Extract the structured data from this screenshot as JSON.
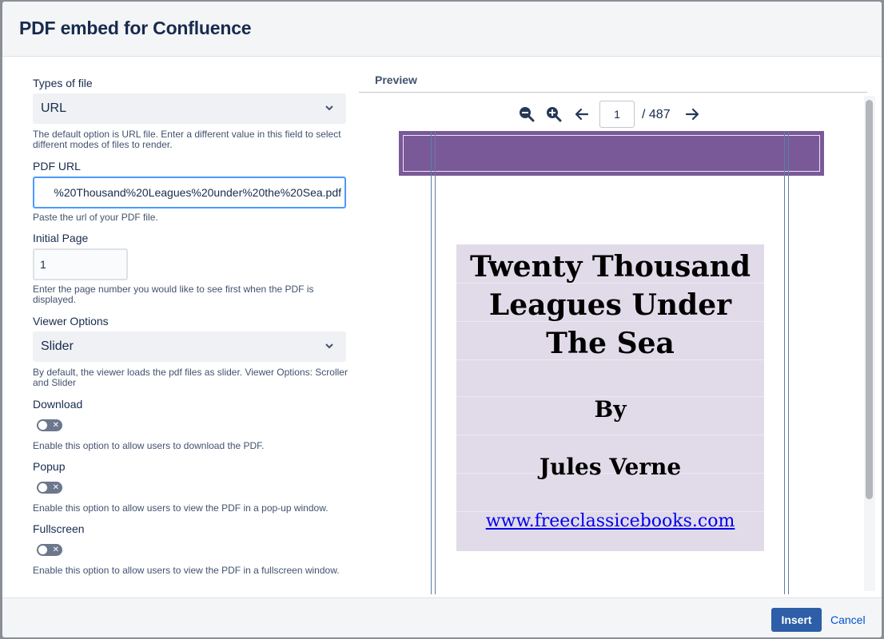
{
  "header": {
    "title": "PDF embed for Confluence"
  },
  "form": {
    "types_label": "Types of file",
    "types_value": "URL",
    "types_help": "The default option is URL file. Enter a different value in this field to select different modes of files to render.",
    "url_label": "PDF URL",
    "url_value": "%20Thousand%20Leagues%20under%20the%20Sea.pdf",
    "url_help": "Paste the url of your PDF file.",
    "page_label": "Initial Page",
    "page_value": "1",
    "page_help": "Enter the page number you would like to see first when the PDF is displayed.",
    "viewer_label": "Viewer Options",
    "viewer_value": "Slider",
    "viewer_help": "By default, the viewer loads the pdf files as slider. Viewer Options: Scroller and Slider",
    "download_label": "Download",
    "download_help": "Enable this option to allow users to download the PDF.",
    "popup_label": "Popup",
    "popup_help": "Enable this option to allow users to view the PDF in a pop-up window.",
    "fullscreen_label": "Fullscreen",
    "fullscreen_help": "Enable this option to allow users to view the PDF in a fullscreen window.",
    "toggle_off_glyph": "✕"
  },
  "preview": {
    "tab_label": "Preview",
    "current_page": "1",
    "total_pages": "/  487",
    "book": {
      "title": "Twenty Thousand Leagues Under The Sea",
      "by": "By",
      "author": "Jules Verne",
      "link": "www.freeclassicebooks.com"
    }
  },
  "footer": {
    "insert_label": "Insert",
    "cancel_label": "Cancel"
  },
  "colors": {
    "primary": "#2d5ea7",
    "link": "#0052cc",
    "banner": "#7a5998",
    "focus": "#4c9aff"
  }
}
